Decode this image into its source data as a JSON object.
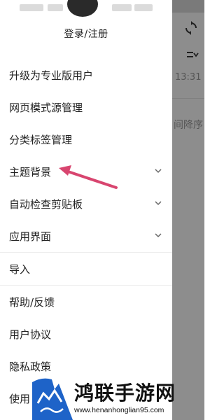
{
  "drawer": {
    "login_label": "登录/注册",
    "menu_items": [
      {
        "label": "升级为专业版用户"
      },
      {
        "label": "网页模式源管理"
      },
      {
        "label": "分类标签管理"
      },
      {
        "label": "主题背景",
        "expand_icon": "chevron-down-icon"
      },
      {
        "label": "自动检查剪贴板",
        "expand_icon": "chevron-down-icon"
      },
      {
        "label": "应用界面",
        "expand_icon": "chevron-down-icon"
      },
      {
        "label": "导入"
      },
      {
        "label": "帮助/反馈"
      },
      {
        "label": "用户协议"
      },
      {
        "label": "隐私政策"
      },
      {
        "label": "使用"
      }
    ]
  },
  "background_app": {
    "time": "13:31",
    "sort_label": "间降序",
    "icons": [
      "sync-icon",
      "sort-icon"
    ]
  },
  "annotation": {
    "type": "arrow",
    "color": "#d8456f",
    "points_to": "主题背景"
  },
  "watermark": {
    "title": "鸿联手游网",
    "url": "www.henanhonglian95.com",
    "colors": {
      "blue": "#1e63c8",
      "dark": "#111111"
    }
  }
}
